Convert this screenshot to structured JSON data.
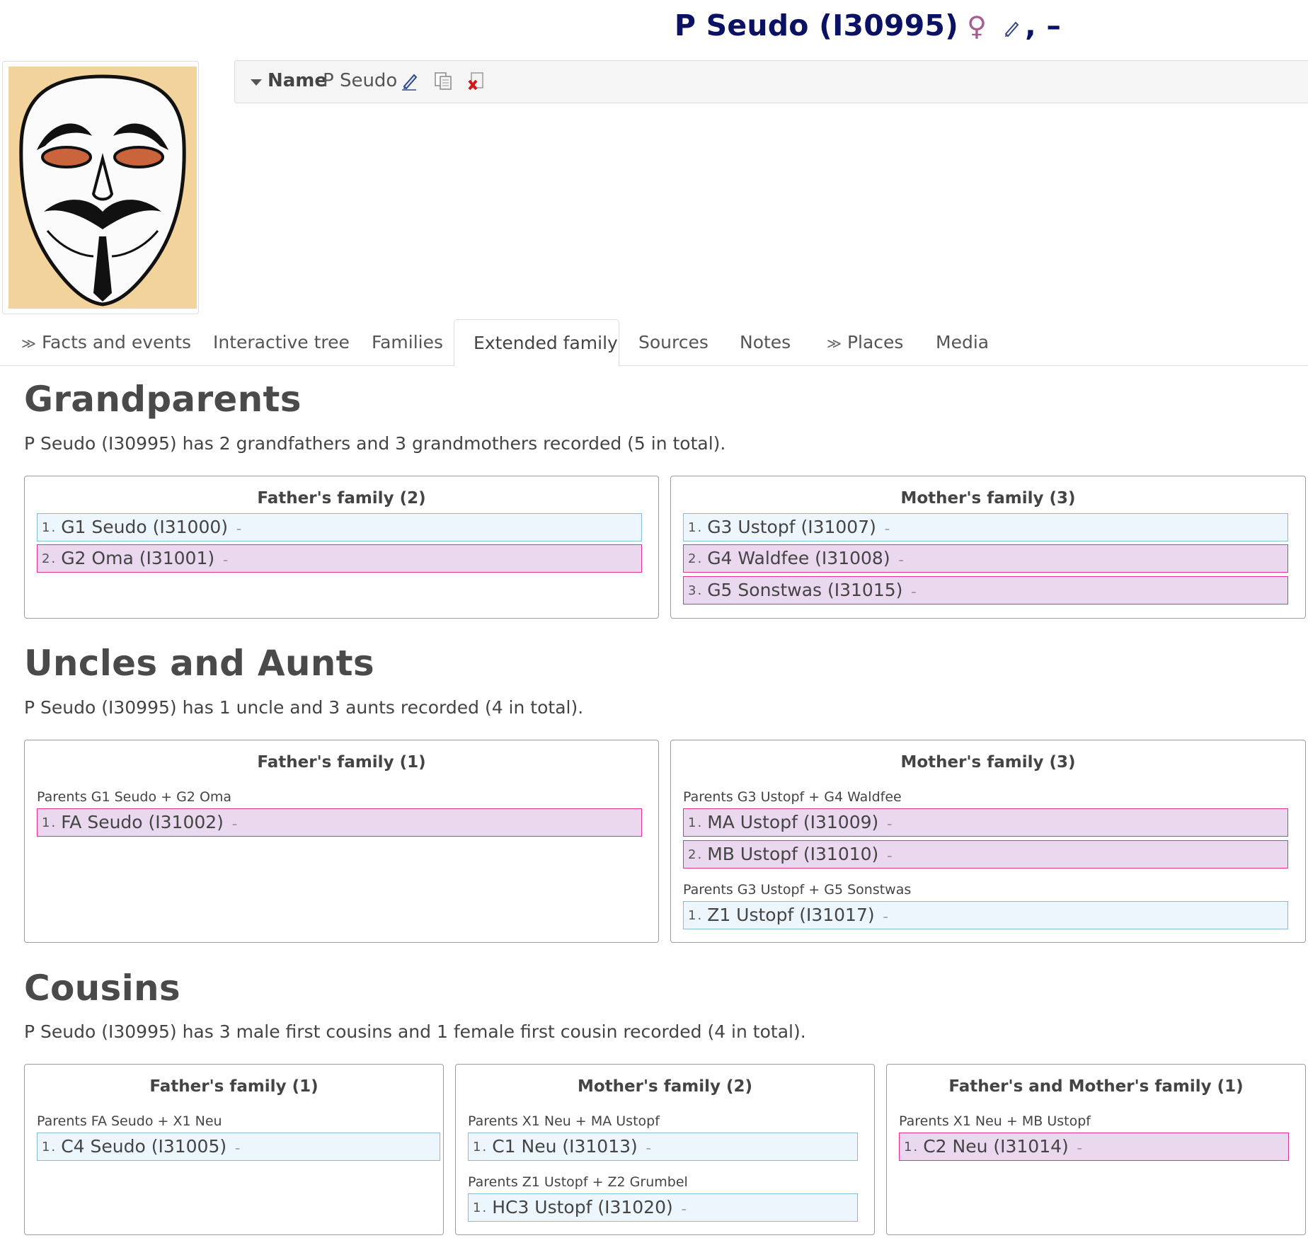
{
  "header": {
    "title": "P Seudo (I30995)",
    "gender_symbol": "♀",
    "tail": ", –",
    "edit_icon": "pencil-icon"
  },
  "photo": {
    "subject": "Guy Fawkes mask",
    "icon": "mask-image"
  },
  "name_bar": {
    "label": "Name",
    "value": "P Seudo",
    "icons": [
      "pencil-icon",
      "copy-icon",
      "delete-icon"
    ]
  },
  "tabs": [
    {
      "label": "Facts and events",
      "icon": "expand-icon"
    },
    {
      "label": "Interactive tree"
    },
    {
      "label": "Families"
    },
    {
      "label": "Extended family",
      "active": true
    },
    {
      "label": "Sources"
    },
    {
      "label": "Notes"
    },
    {
      "label": "Places",
      "icon": "expand-icon"
    },
    {
      "label": "Media"
    }
  ],
  "sections": [
    {
      "heading": "Grandparents",
      "summary": "P Seudo (I30995) has 2 grandfathers and 3 grandmothers recorded (5 in total).",
      "cards": [
        {
          "header": "Father's family (2)",
          "groups": [
            {
              "parents": "",
              "people": [
                {
                  "num": "1",
                  "name": "G1 Seudo (I31000)",
                  "dates": "–",
                  "sex": "male"
                },
                {
                  "num": "2",
                  "name": "G2 Oma (I31001)",
                  "dates": "–",
                  "sex": "female"
                }
              ]
            }
          ]
        },
        {
          "header": "Mother's family (3)",
          "groups": [
            {
              "parents": "",
              "people": [
                {
                  "num": "1",
                  "name": "G3 Ustopf (I31007)",
                  "dates": "–",
                  "sex": "male"
                },
                {
                  "num": "2",
                  "name": "G4 Waldfee (I31008)",
                  "dates": "–",
                  "sex": "female"
                },
                {
                  "num": "3",
                  "name": "G5 Sonstwas (I31015)",
                  "dates": "–",
                  "sex": "female"
                }
              ]
            }
          ]
        }
      ]
    },
    {
      "heading": "Uncles and Aunts",
      "summary": "P Seudo (I30995) has 1 uncle and 3 aunts recorded (4 in total).",
      "cards": [
        {
          "header": "Father's family (1)",
          "groups": [
            {
              "parents": "Parents G1 Seudo + G2 Oma",
              "people": [
                {
                  "num": "1",
                  "name": "FA Seudo (I31002)",
                  "dates": "–",
                  "sex": "female"
                }
              ]
            }
          ]
        },
        {
          "header": "Mother's family (3)",
          "groups": [
            {
              "parents": "Parents G3 Ustopf + G4 Waldfee",
              "people": [
                {
                  "num": "1",
                  "name": "MA Ustopf (I31009)",
                  "dates": "–",
                  "sex": "female"
                },
                {
                  "num": "2",
                  "name": "MB Ustopf (I31010)",
                  "dates": "–",
                  "sex": "female"
                }
              ]
            },
            {
              "parents": "Parents G3 Ustopf + G5 Sonstwas",
              "people": [
                {
                  "num": "1",
                  "name": "Z1 Ustopf (I31017)",
                  "dates": "–",
                  "sex": "male"
                }
              ]
            }
          ]
        }
      ]
    },
    {
      "heading": "Cousins",
      "summary": "P Seudo (I30995) has 3 male first cousins and 1 female first cousin recorded (4 in total).",
      "cards": [
        {
          "header": "Father's family (1)",
          "groups": [
            {
              "parents": "Parents FA Seudo + X1 Neu",
              "people": [
                {
                  "num": "1",
                  "name": "C4 Seudo (I31005)",
                  "dates": "–",
                  "sex": "male"
                }
              ]
            }
          ]
        },
        {
          "header": "Mother's family (2)",
          "groups": [
            {
              "parents": "Parents X1 Neu + MA Ustopf",
              "people": [
                {
                  "num": "1",
                  "name": "C1 Neu (I31013)",
                  "dates": "–",
                  "sex": "male"
                }
              ]
            },
            {
              "parents": "Parents Z1 Ustopf + Z2 Grumbel",
              "people": [
                {
                  "num": "1",
                  "name": "HC3 Ustopf (I31020)",
                  "dates": "–",
                  "sex": "male"
                }
              ]
            }
          ]
        },
        {
          "header": "Father's and Mother's family (1)",
          "groups": [
            {
              "parents": "Parents X1 Neu + MB Ustopf",
              "people": [
                {
                  "num": "1",
                  "name": "C2 Neu (I31014)",
                  "dates": "–",
                  "sex": "female"
                }
              ]
            }
          ]
        }
      ]
    }
  ],
  "colors": {
    "title": "#0b1163",
    "gender_female": "#a85b8e",
    "male_row_bg": "#eef6fd",
    "male_row_border": "#88bcd7",
    "female_row_bg": "#ead8ef",
    "female_row_border": "#e2318f"
  }
}
